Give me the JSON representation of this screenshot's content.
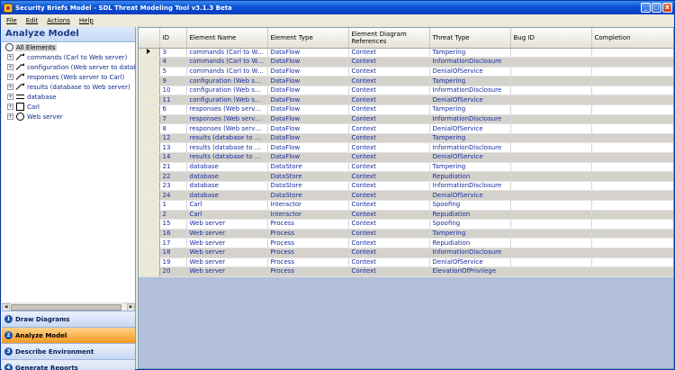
{
  "window": {
    "title": "Security Briefs Model - SDL Threat Modeling Tool v3.1.3 Beta",
    "buttons": [
      "_",
      "□",
      "x"
    ]
  },
  "menu": [
    "File",
    "Edit",
    "Actions",
    "Help"
  ],
  "left": {
    "header": "Analyze Model",
    "root": "All Elements",
    "tree": [
      {
        "label": "commands (Carl to Web server)",
        "shape": "arrow"
      },
      {
        "label": "configuration (Web server to datab",
        "shape": "arrow"
      },
      {
        "label": "responses (Web server to Carl)",
        "shape": "arrow"
      },
      {
        "label": "results (database to Web server)",
        "shape": "arrow"
      },
      {
        "label": "database",
        "shape": "store"
      },
      {
        "label": "Carl",
        "shape": "box"
      },
      {
        "label": "Web server",
        "shape": "circle"
      }
    ],
    "nav": [
      {
        "num": "1",
        "label": "Draw Diagrams"
      },
      {
        "num": "2",
        "label": "Analyze Model"
      },
      {
        "num": "3",
        "label": "Describe Environment"
      },
      {
        "num": "4",
        "label": "Generate Reports"
      }
    ]
  },
  "grid": {
    "columns": [
      "ID",
      "Element Name",
      "Element Type",
      "Element Diagram References",
      "Threat Type",
      "Bug ID",
      "Completion"
    ],
    "rows": [
      [
        "3",
        "commands (Carl to We...",
        "DataFlow",
        "Context",
        "Tampering",
        "",
        ""
      ],
      [
        "4",
        "commands (Carl to We...",
        "DataFlow",
        "Context",
        "InformationDisclosure",
        "",
        ""
      ],
      [
        "5",
        "commands (Carl to We...",
        "DataFlow",
        "Context",
        "DenialOfService",
        "",
        ""
      ],
      [
        "9",
        "configuration (Web se...",
        "DataFlow",
        "Context",
        "Tampering",
        "",
        ""
      ],
      [
        "10",
        "configuration (Web se...",
        "DataFlow",
        "Context",
        "InformationDisclosure",
        "",
        ""
      ],
      [
        "11",
        "configuration (Web se...",
        "DataFlow",
        "Context",
        "DenialOfService",
        "",
        ""
      ],
      [
        "6",
        "responses (Web server t...",
        "DataFlow",
        "Context",
        "Tampering",
        "",
        ""
      ],
      [
        "7",
        "responses (Web server t...",
        "DataFlow",
        "Context",
        "InformationDisclosure",
        "",
        ""
      ],
      [
        "8",
        "responses (Web server t...",
        "DataFlow",
        "Context",
        "DenialOfService",
        "",
        ""
      ],
      [
        "12",
        "results (database to We...",
        "DataFlow",
        "Context",
        "Tampering",
        "",
        ""
      ],
      [
        "13",
        "results (database to We...",
        "DataFlow",
        "Context",
        "InformationDisclosure",
        "",
        ""
      ],
      [
        "14",
        "results (database to We...",
        "DataFlow",
        "Context",
        "DenialOfService",
        "",
        ""
      ],
      [
        "21",
        "database",
        "DataStore",
        "Context",
        "Tampering",
        "",
        ""
      ],
      [
        "22",
        "database",
        "DataStore",
        "Context",
        "Repudiation",
        "",
        ""
      ],
      [
        "23",
        "database",
        "DataStore",
        "Context",
        "InformationDisclosure",
        "",
        ""
      ],
      [
        "24",
        "database",
        "DataStore",
        "Context",
        "DenialOfService",
        "",
        ""
      ],
      [
        "1",
        "Carl",
        "Interactor",
        "Context",
        "Spoofing",
        "",
        ""
      ],
      [
        "2",
        "Carl",
        "Interactor",
        "Context",
        "Repudiation",
        "",
        ""
      ],
      [
        "15",
        "Web server",
        "Process",
        "Context",
        "Spoofing",
        "",
        ""
      ],
      [
        "16",
        "Web server",
        "Process",
        "Context",
        "Tampering",
        "",
        ""
      ],
      [
        "17",
        "Web server",
        "Process",
        "Context",
        "Repudiation",
        "",
        ""
      ],
      [
        "18",
        "Web server",
        "Process",
        "Context",
        "InformationDisclosure",
        "",
        ""
      ],
      [
        "19",
        "Web server",
        "Process",
        "Context",
        "DenialOfService",
        "",
        ""
      ],
      [
        "20",
        "Web server",
        "Process",
        "Context",
        "ElevationOfPrivilege",
        "",
        ""
      ]
    ]
  }
}
